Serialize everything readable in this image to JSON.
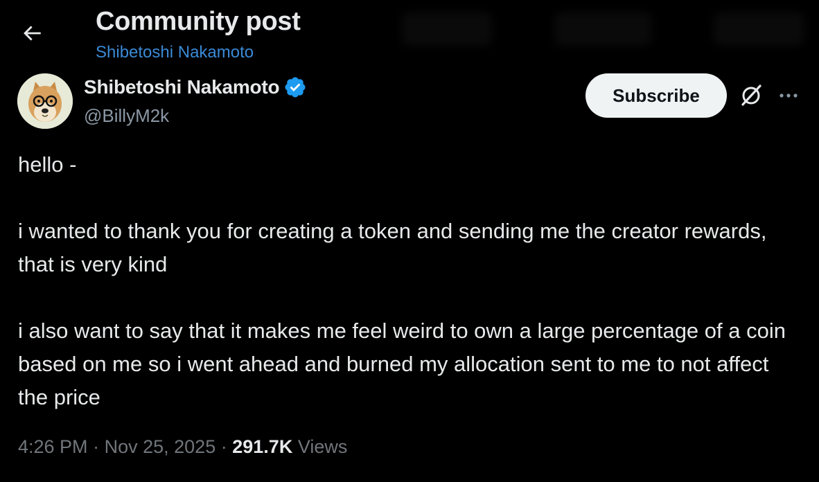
{
  "header": {
    "title": "Community post",
    "subtitle": "Shibetoshi Nakamoto",
    "back_icon": "arrow-left-icon"
  },
  "author": {
    "name": "Shibetoshi Nakamoto",
    "handle": "@BillyM2k",
    "verified": true,
    "verified_color": "#1d9bf0",
    "avatar": "doge-avatar"
  },
  "actions": {
    "subscribe_label": "Subscribe",
    "grok_icon": "grok-icon",
    "more_icon": "more-icon"
  },
  "post": {
    "paragraphs": [
      "hello -",
      "i wanted to thank you for creating a token and sending me the creator rewards, that is very kind",
      "i also want to say that it makes me feel weird to own a large percentage of a coin based on me so i went ahead and burned my allocation sent to me to not affect the price"
    ]
  },
  "meta": {
    "time": "4:26 PM",
    "separator": "·",
    "date": "Nov 25, 2025",
    "views_count": "291.7K",
    "views_label": "Views"
  },
  "colors": {
    "background": "#000000",
    "text": "#e7e9ea",
    "secondary": "#71767b",
    "link": "#3a8ad6"
  }
}
